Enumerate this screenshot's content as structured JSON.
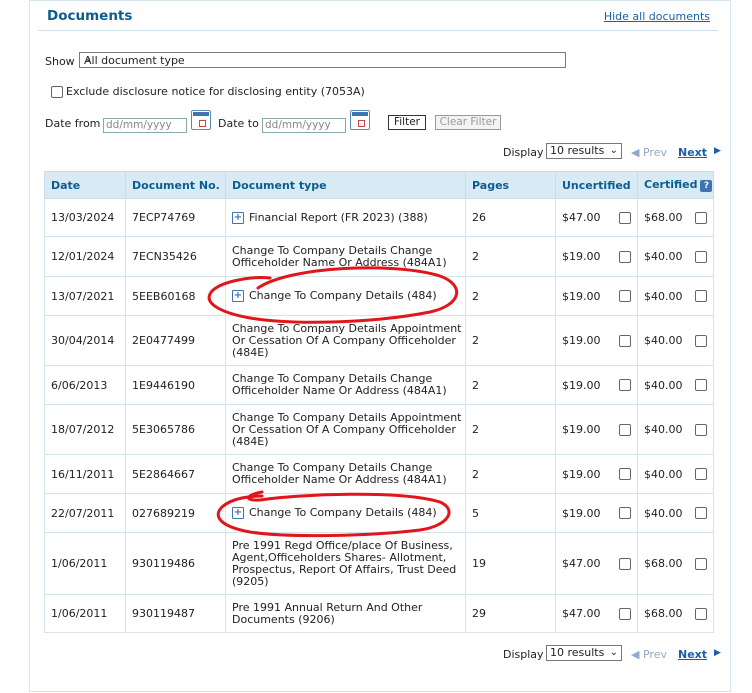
{
  "header": {
    "title": "Documents",
    "hide_link": "Hide all documents"
  },
  "filter": {
    "show_label": "Show",
    "show_value": "All document type",
    "exclude_label": "Exclude disclosure notice for disclosing entity (7053A)",
    "date_from_label": "Date from",
    "date_to_label": "Date to",
    "date_placeholder": "dd/mm/yyyy",
    "filter_button": "Filter",
    "clear_button": "Clear Filter"
  },
  "pagination": {
    "display_label": "Display",
    "display_value": "10 results",
    "prev": "Prev",
    "next": "Next"
  },
  "table": {
    "headers": [
      "Date",
      "Document No.",
      "Document type",
      "Pages",
      "Uncertified",
      "Certified"
    ],
    "help_icon": "?",
    "rows": [
      {
        "date": "13/03/2024",
        "docno": "7ECP74769",
        "type": "Financial Report (FR 2023) (388)",
        "expand": true,
        "pages": "26",
        "uncert": "$47.00",
        "cert": "$68.00"
      },
      {
        "date": "12/01/2024",
        "docno": "7ECN35426",
        "type": "Change To Company Details Change Officeholder Name Or Address (484A1)",
        "expand": false,
        "pages": "2",
        "uncert": "$19.00",
        "cert": "$40.00"
      },
      {
        "date": "13/07/2021",
        "docno": "5EEB60168",
        "type": "Change To Company Details (484)",
        "expand": true,
        "pages": "2",
        "uncert": "$19.00",
        "cert": "$40.00"
      },
      {
        "date": "30/04/2014",
        "docno": "2E0477499",
        "type": "Change To Company Details Appointment Or Cessation Of A Company Officeholder (484E)",
        "expand": false,
        "pages": "2",
        "uncert": "$19.00",
        "cert": "$40.00"
      },
      {
        "date": "6/06/2013",
        "docno": "1E9446190",
        "type": "Change To Company Details Change Officeholder Name Or Address (484A1)",
        "expand": false,
        "pages": "2",
        "uncert": "$19.00",
        "cert": "$40.00"
      },
      {
        "date": "18/07/2012",
        "docno": "5E3065786",
        "type": "Change To Company Details Appointment Or Cessation Of A Company Officeholder (484E)",
        "expand": false,
        "pages": "2",
        "uncert": "$19.00",
        "cert": "$40.00"
      },
      {
        "date": "16/11/2011",
        "docno": "5E2864667",
        "type": "Change To Company Details Change Officeholder Name Or Address (484A1)",
        "expand": false,
        "pages": "2",
        "uncert": "$19.00",
        "cert": "$40.00"
      },
      {
        "date": "22/07/2011",
        "docno": "027689219",
        "type": "Change To Company Details (484)",
        "expand": true,
        "pages": "5",
        "uncert": "$19.00",
        "cert": "$40.00"
      },
      {
        "date": "1/06/2011",
        "docno": "930119486",
        "type": "Pre 1991 Regd Office/place Of Business, Agent,Officeholders Shares- Allotment, Prospectus, Report Of Affairs, Trust Deed (9205)",
        "expand": false,
        "pages": "19",
        "uncert": "$47.00",
        "cert": "$68.00"
      },
      {
        "date": "1/06/2011",
        "docno": "930119487",
        "type": "Pre 1991 Annual Return And Other Documents (9206)",
        "expand": false,
        "pages": "29",
        "uncert": "$47.00",
        "cert": "$68.00"
      }
    ]
  },
  "annotation_color": "#e0161b"
}
